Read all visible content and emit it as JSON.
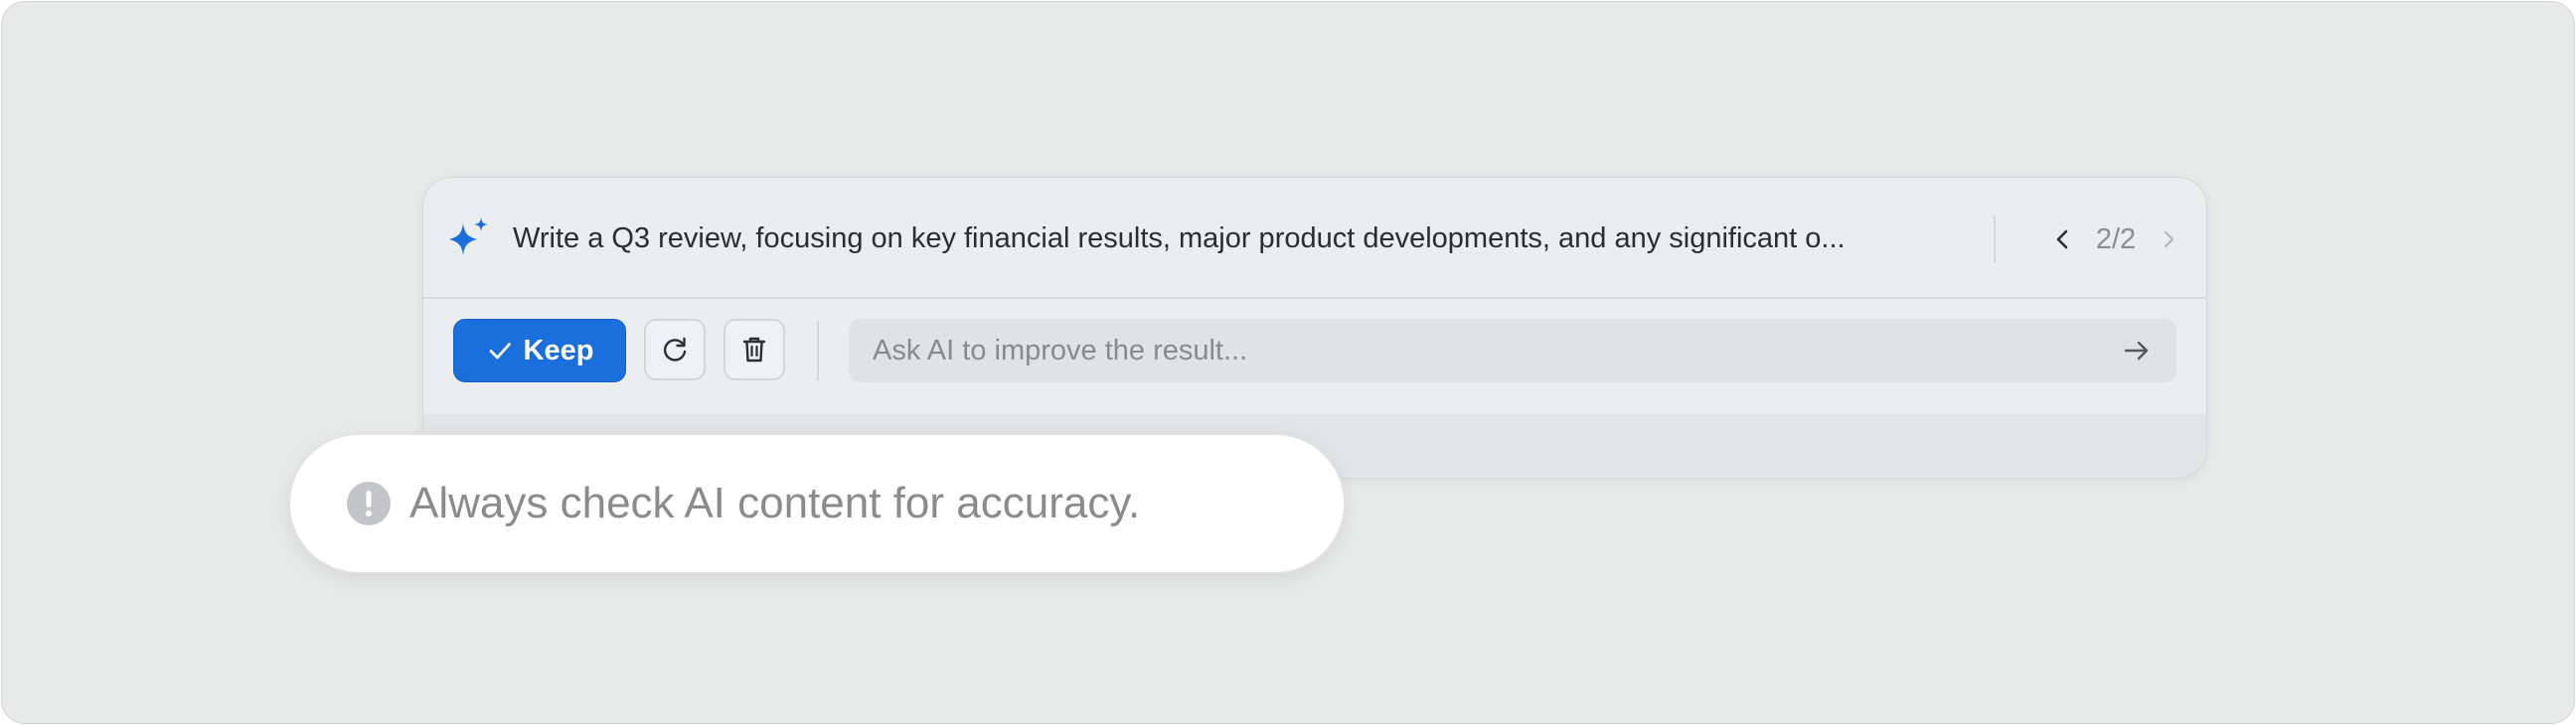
{
  "prompt": {
    "text": "Write a Q3 review, focusing on key financial results, major product developments, and any significant o...",
    "icon": "sparkle-icon"
  },
  "pager": {
    "count": "2/2",
    "prev_icon": "chevron-left-icon",
    "next_icon": "chevron-right-icon"
  },
  "actions": {
    "keep_label": "Keep",
    "keep_icon": "check-icon",
    "regenerate_icon": "refresh-icon",
    "delete_icon": "trash-icon"
  },
  "ask": {
    "placeholder": "Ask AI to improve the result...",
    "value": "",
    "send_icon": "arrow-right-icon"
  },
  "toast": {
    "text": "Always check AI content for accuracy.",
    "icon": "exclamation-circle-icon"
  },
  "colors": {
    "accent": "#1a6fdc",
    "background": "#e8eae9",
    "panel": "#ecedef",
    "muted_text": "#8a8b8d"
  }
}
